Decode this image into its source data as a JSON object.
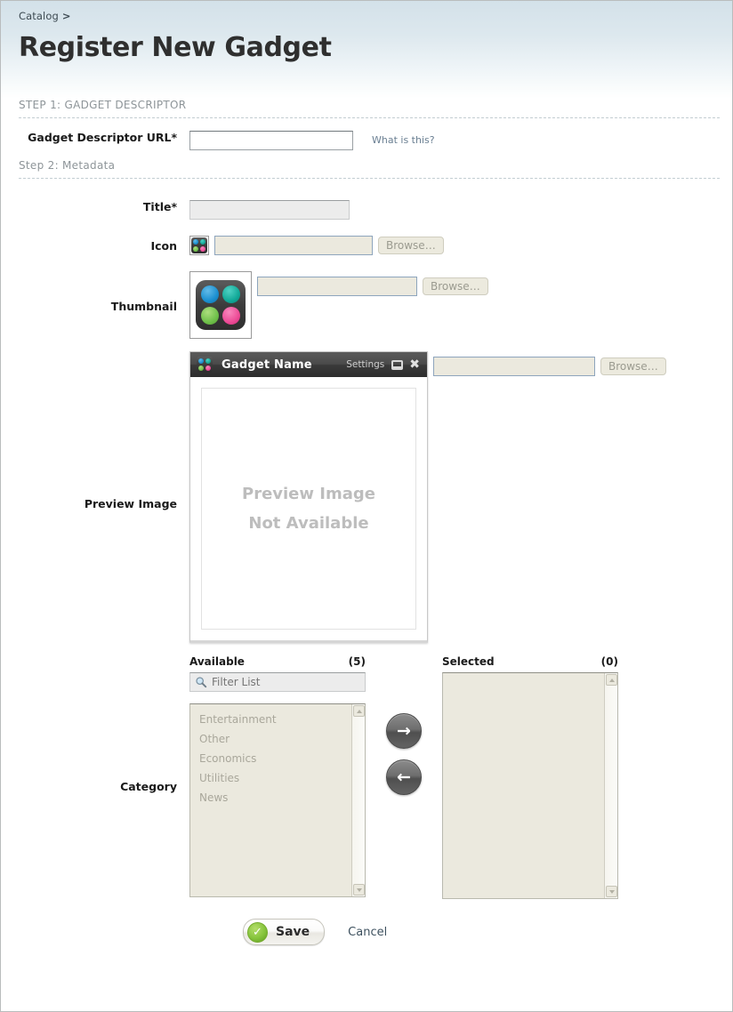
{
  "breadcrumb": {
    "root": "Catalog",
    "separator": ">"
  },
  "page_title": "Register New Gadget",
  "steps": {
    "step1": "STEP 1: GADGET DESCRIPTOR",
    "step2": "Step 2: Metadata"
  },
  "fields": {
    "descriptor_url": {
      "label": "Gadget Descriptor URL*",
      "value": "",
      "placeholder": "",
      "help_link": "What is this?"
    },
    "title": {
      "label": "Title*",
      "value": "",
      "placeholder": ""
    },
    "icon": {
      "label": "Icon",
      "value": "",
      "placeholder": "",
      "browse_label": "Browse…",
      "preview_icon": "gadget-icon"
    },
    "thumbnail": {
      "label": "Thumbnail",
      "value": "",
      "placeholder": "",
      "browse_label": "Browse…",
      "preview_icon": "gadget-icon-large"
    },
    "preview_image": {
      "label": "Preview Image",
      "value": "",
      "placeholder": "",
      "browse_label": "Browse…"
    }
  },
  "gadget_preview": {
    "title": "Gadget Name",
    "settings_label": "Settings",
    "minimize_icon": "minimize-icon",
    "close_icon": "close-icon",
    "placeholder_line1": "Preview Image",
    "placeholder_line2": "Not Available"
  },
  "category": {
    "label": "Category",
    "available": {
      "heading": "Available",
      "count": "(5)",
      "filter_placeholder": "Filter List",
      "filter_value": "",
      "items": [
        "Entertainment",
        "Other",
        "Economics",
        "Utilities",
        "News"
      ]
    },
    "selected": {
      "heading": "Selected",
      "count": "(0)",
      "items": []
    },
    "add_arrow": "→",
    "remove_arrow": "←"
  },
  "footer": {
    "save_label": "Save",
    "cancel_label": "Cancel"
  },
  "colors": {
    "header_top": "#d3e1e9",
    "accent_link": "#6a7f92",
    "field_disabled_bg": "#ececec",
    "list_bg": "#ebe9de",
    "save_green": "#86c43c"
  }
}
